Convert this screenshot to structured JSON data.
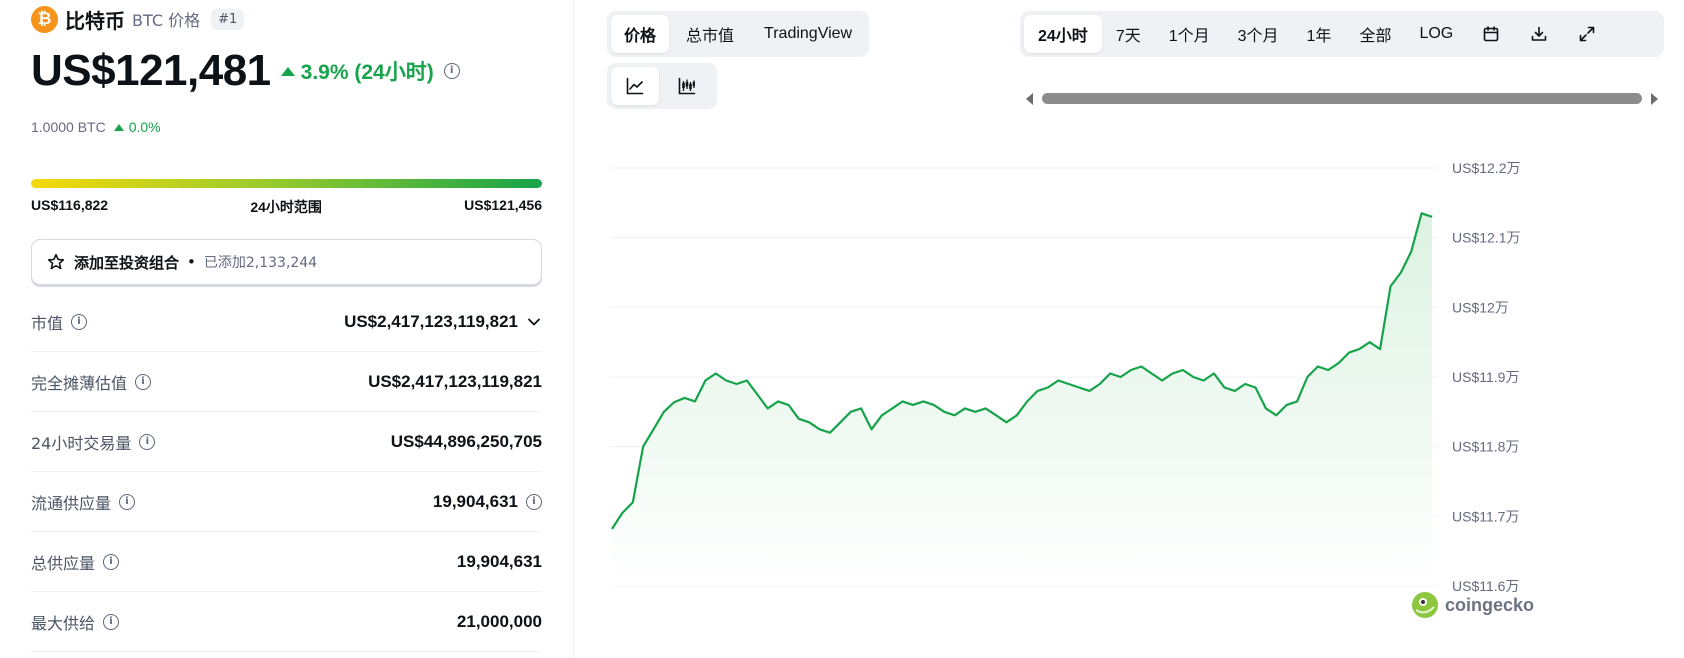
{
  "coin": {
    "name": "比特币",
    "symbol_label": "BTC 价格",
    "rank": "#1",
    "logo_glyph": "₿",
    "logo_color": "#f7931a"
  },
  "price": {
    "value": "US$121,481",
    "change": "3.9% (24小时)",
    "btc_value": "1.0000 BTC",
    "btc_change": "0.0%"
  },
  "range24h": {
    "low": "US$116,822",
    "label": "24小时范围",
    "high": "US$121,456"
  },
  "portfolio": {
    "label": "添加至投资组合",
    "dot": "•",
    "added": "已添加2,133,244"
  },
  "stats": [
    {
      "label": "市值",
      "value": "US$2,417,123,119,821"
    },
    {
      "label": "完全摊薄估值",
      "value": "US$2,417,123,119,821"
    },
    {
      "label": "24小时交易量",
      "value": "US$44,896,250,705"
    },
    {
      "label": "流通供应量",
      "value": "19,904,631"
    },
    {
      "label": "总供应量",
      "value": "19,904,631"
    },
    {
      "label": "最大供给",
      "value": "21,000,000"
    }
  ],
  "type_tabs": [
    {
      "label": "价格",
      "active": true
    },
    {
      "label": "总市值",
      "active": false
    },
    {
      "label": "TradingView",
      "active": false
    }
  ],
  "chart_tabs": [
    {
      "icon": "line-chart-icon",
      "active": true
    },
    {
      "icon": "candlestick-chart-icon",
      "active": false
    }
  ],
  "range_tabs": [
    {
      "label": "24小时",
      "active": true
    },
    {
      "label": "7天",
      "active": false
    },
    {
      "label": "1个月",
      "active": false
    },
    {
      "label": "3个月",
      "active": false
    },
    {
      "label": "1年",
      "active": false
    },
    {
      "label": "全部",
      "active": false
    },
    {
      "label": "LOG",
      "active": false
    }
  ],
  "range_icons": [
    "calendar-icon",
    "download-icon",
    "fullscreen-icon"
  ],
  "watermark": "coingecko",
  "colors": {
    "up": "#16a34a",
    "line": "#16a34a",
    "fill": "#dcf2e2"
  },
  "chart_data": {
    "type": "area",
    "title": "",
    "xlabel": "",
    "ylabel": "",
    "ylim": [
      116000,
      122000
    ],
    "yticks": [
      116000,
      117000,
      118000,
      119000,
      120000,
      121000,
      122000
    ],
    "ytick_labels": [
      "US$11.6万",
      "US$11.7万",
      "US$11.8万",
      "US$11.9万",
      "US$12万",
      "US$12.1万",
      "US$12.2万"
    ],
    "grid": true,
    "series": [
      {
        "values": [
          116820,
          117050,
          117200,
          118000,
          118250,
          118500,
          118640,
          118700,
          118650,
          118950,
          119050,
          118950,
          118900,
          118950,
          118750,
          118550,
          118650,
          118600,
          118400,
          118350,
          118250,
          118200,
          118350,
          118500,
          118550,
          118250,
          118450,
          118550,
          118650,
          118600,
          118650,
          118600,
          118500,
          118450,
          118550,
          118500,
          118550,
          118450,
          118350,
          118450,
          118650,
          118800,
          118850,
          118950,
          118900,
          118850,
          118800,
          118900,
          119050,
          119000,
          119100,
          119150,
          119050,
          118950,
          119050,
          119100,
          119000,
          118950,
          119050,
          118850,
          118800,
          118900,
          118850,
          118550,
          118450,
          118600,
          118650,
          119000,
          119150,
          119100,
          119200,
          119350,
          119400,
          119500,
          119400,
          120300,
          120500,
          120800,
          121350,
          121300
        ]
      }
    ]
  }
}
